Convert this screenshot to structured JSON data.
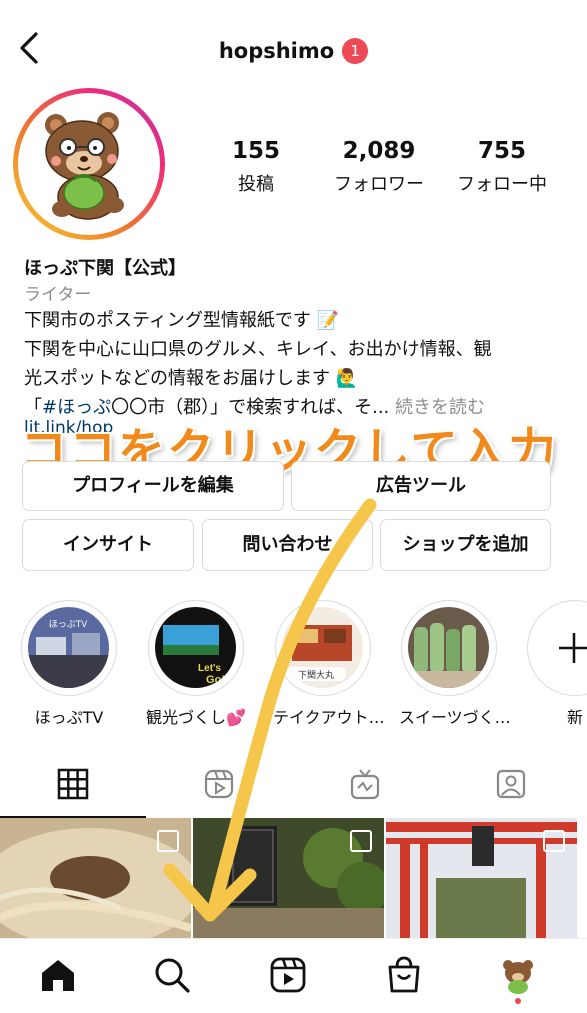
{
  "header": {
    "username": "hopshimo",
    "notification_count": "1"
  },
  "stats": [
    {
      "value": "155",
      "label": "投稿"
    },
    {
      "value": "2,089",
      "label": "フォロワー"
    },
    {
      "value": "755",
      "label": "フォロー中"
    }
  ],
  "profile": {
    "display_name": "ほっぷ下関【公式】",
    "category": "ライター",
    "bio_line1": "下関市のポスティング型情報紙です",
    "bio_line2": "下関を中心に山口県のグルメ、キレイ、お出かけ情報、観",
    "bio_line3": "光スポットなどの情報をお届けします",
    "bio_line4_hashtag": "#ほっぷ",
    "bio_line4_rest": "〇〇市（郡）」で検索すれば、そ...",
    "bio_more": "続きを読む",
    "link_partial": "lit.link/hop"
  },
  "overlay_caption": "ココをクリックして入力",
  "buttons": {
    "edit_profile": "プロフィールを編集",
    "ad_tools": "広告ツール",
    "insights": "インサイト",
    "contact": "問い合わせ",
    "add_shop": "ショップを追加"
  },
  "highlights": [
    {
      "label": "ほっぷTV"
    },
    {
      "label": "観光づくし💕"
    },
    {
      "label": "テイクアウト…"
    },
    {
      "label": "スイーツづく…"
    },
    {
      "label": "新"
    }
  ],
  "colors": {
    "accent_red": "#ed4956",
    "caption_orange": "#f28a1b",
    "arrow_yellow": "#f5c64a",
    "border": "#dbdbdb"
  },
  "icons": {
    "tabs": [
      "grid-icon",
      "reels-icon",
      "igtv-icon",
      "tagged-icon"
    ],
    "nav": [
      "home-icon",
      "search-icon",
      "reels-icon",
      "shop-icon",
      "profile-avatar"
    ]
  }
}
